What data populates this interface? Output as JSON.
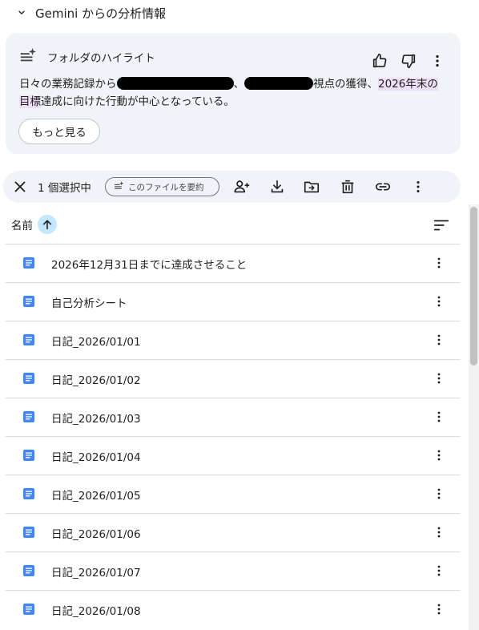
{
  "gemini": {
    "header_title": "Gemini からの分析情報",
    "card_title": "フォルダのハイライト",
    "body_part1": "日々の業務記録から",
    "body_part2": "、",
    "body_part3": "視点の獲得、",
    "body_highlight1": "2026年末の",
    "body_highlight2": "目標",
    "body_part4": "達成に向けた行動が中心となっている。",
    "more_button": "もっと見る"
  },
  "selection_bar": {
    "count_label": "1 個選択中",
    "summarize_label": "このファイルを要約"
  },
  "list_header": {
    "name_label": "名前"
  },
  "files": [
    "2026年12月31日までに達成させること",
    "自己分析シート",
    "日記_2026/01/01",
    "日記_2026/01/02",
    "日記_2026/01/03",
    "日記_2026/01/04",
    "日記_2026/01/05",
    "日記_2026/01/06",
    "日記_2026/01/07",
    "日記_2026/01/08"
  ],
  "colors": {
    "card_bg": "#f0f4f9",
    "doc_blue": "#4285f4",
    "sort_highlight": "#c2e7ff",
    "text_highlight": "#ecdff7"
  }
}
